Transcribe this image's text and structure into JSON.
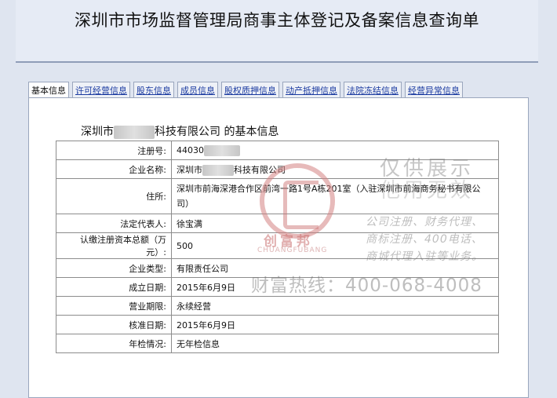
{
  "page_title": "深圳市市场监督管理局商事主体登记及备案信息查询单",
  "tabs": [
    {
      "label": "基本信息",
      "active": true
    },
    {
      "label": "许可经营信息",
      "active": false
    },
    {
      "label": "股东信息",
      "active": false
    },
    {
      "label": "成员信息",
      "active": false
    },
    {
      "label": "股权质押信息",
      "active": false
    },
    {
      "label": "动产抵押信息",
      "active": false
    },
    {
      "label": "法院冻结信息",
      "active": false
    },
    {
      "label": "经营异常信息",
      "active": false
    }
  ],
  "company_heading": {
    "prefix": "深圳市",
    "suffix": "科技有限公司",
    "tail": " 的基本信息"
  },
  "info_rows": {
    "reg_no": {
      "label": "注册号:",
      "value": "44030"
    },
    "name": {
      "label": "企业名称:",
      "prefix": "深圳市",
      "suffix": "科技有限公司"
    },
    "address": {
      "label": "住所:",
      "value": "深圳市前海深港合作区前湾一路1号A栋201室（入驻深圳市前海商务秘书有限公司）"
    },
    "legal_rep": {
      "label": "法定代表人:",
      "value": "徐宝满"
    },
    "capital": {
      "label": "认缴注册资本总额（万元）:",
      "value": "500"
    },
    "type": {
      "label": "企业类型:",
      "value": "有限责任公司"
    },
    "established": {
      "label": "成立日期:",
      "value": "2015年6月9日"
    },
    "term": {
      "label": "营业期限:",
      "value": "永续经营"
    },
    "approved": {
      "label": "核准日期:",
      "value": "2015年6月9日"
    },
    "annual": {
      "label": "年检情况:",
      "value": "无年检信息"
    }
  },
  "watermark": {
    "brand_cn": "创富邦",
    "brand_en": "CHUANGFUBANG",
    "line1": "仅供展示",
    "line2": "他用无效",
    "services": [
      "公司注册、财务代理、",
      "商标注册、400电话、",
      "商城代理入驻等业务。"
    ],
    "hotline": "财富热线：400-068-4008"
  }
}
